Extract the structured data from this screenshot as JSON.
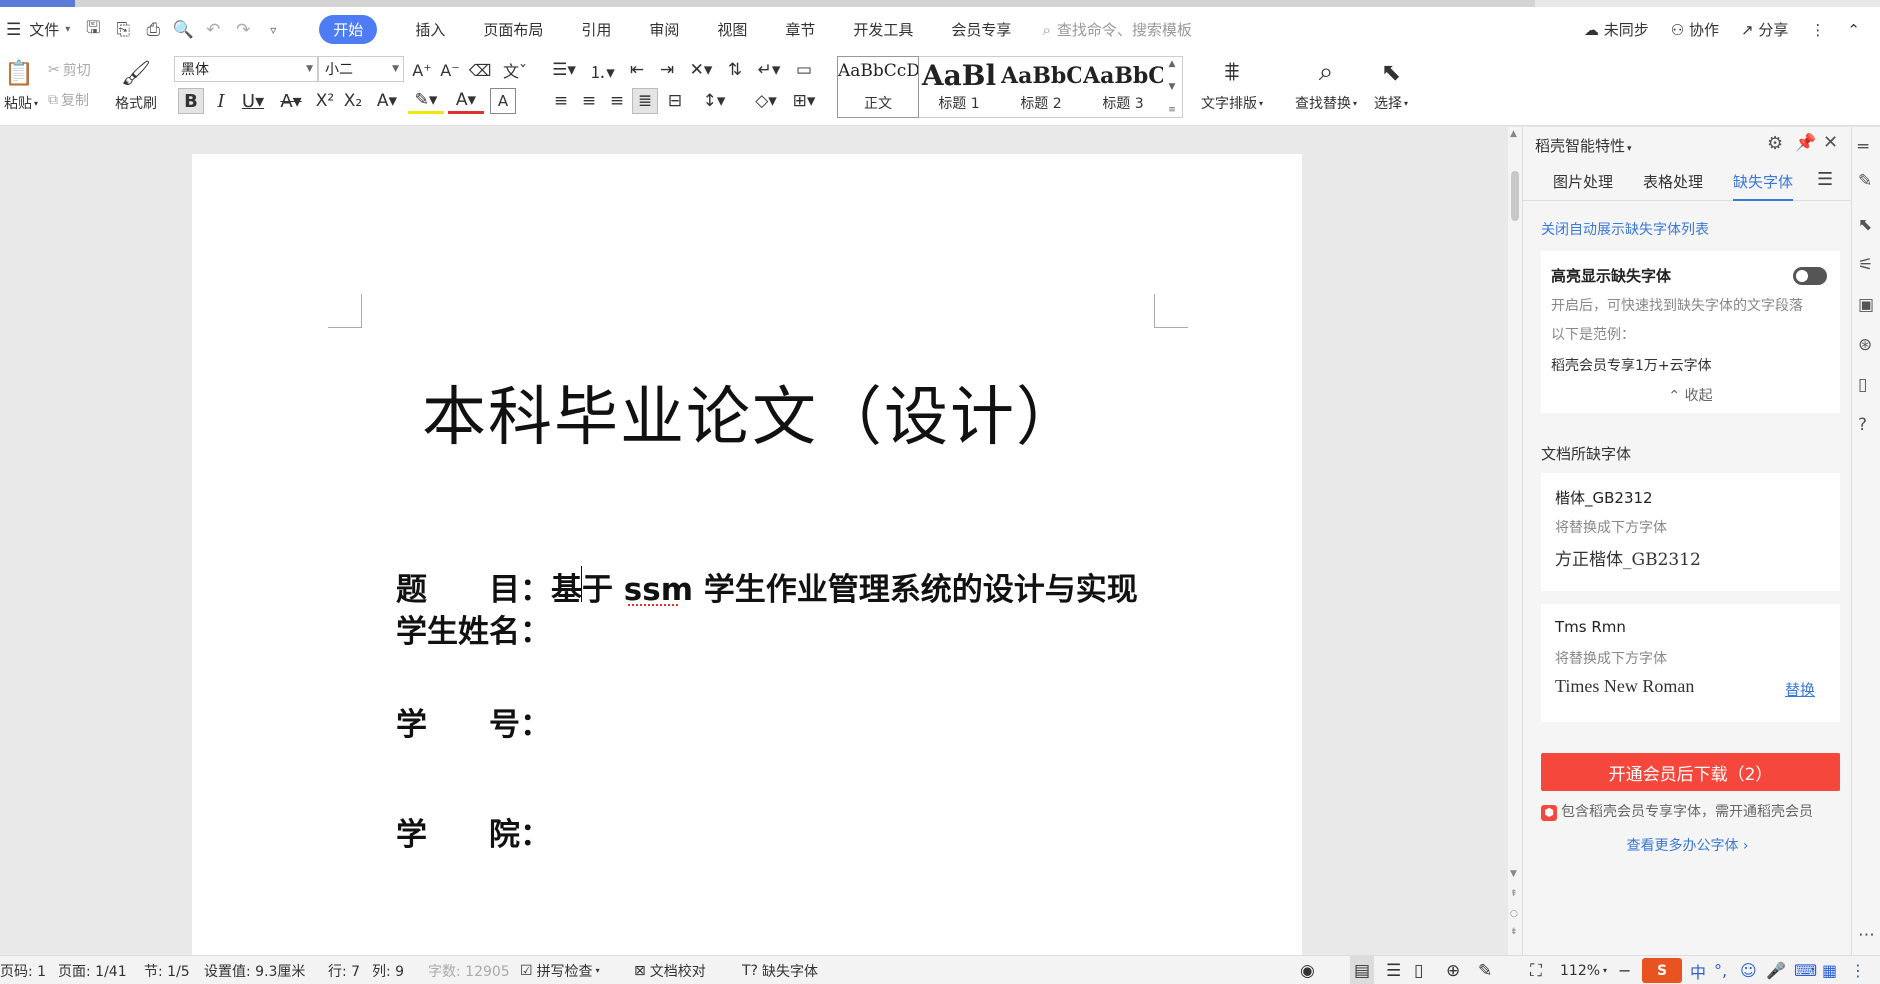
{
  "menubar": {
    "file_label": "文件",
    "tabs": [
      "开始",
      "插入",
      "页面布局",
      "引用",
      "审阅",
      "视图",
      "章节",
      "开发工具",
      "会员专享"
    ],
    "search_placeholder": "查找命令、搜索模板",
    "unsync_label": "未同步",
    "collab_label": "协作",
    "share_label": "分享"
  },
  "ribbon": {
    "paste_label": "粘贴",
    "cut_label": "剪切",
    "copy_label": "复制",
    "format_painter_label": "格式刷",
    "font_name": "黑体",
    "font_size": "小二",
    "styles": [
      {
        "preview": "AaBbCcDd",
        "label": "正文"
      },
      {
        "preview": "AaBl",
        "label": "标题 1"
      },
      {
        "preview": "AaBbC",
        "label": "标题 2"
      },
      {
        "preview": "AaBbC",
        "label": "标题 3"
      }
    ],
    "text_layout_label": "文字排版",
    "find_replace_label": "查找替换",
    "select_label": "选择"
  },
  "document": {
    "title": "本科毕业论文（设计）",
    "lines": [
      {
        "label": "题　　目：",
        "value": "基于 ssm 学生作业管理系统的设计与实现"
      },
      {
        "label": "学生姓名：",
        "value": ""
      },
      {
        "label": "学　　号：",
        "value": ""
      },
      {
        "label": "学　　院：",
        "value": ""
      }
    ]
  },
  "panel": {
    "title": "稻壳智能特性",
    "tabs": [
      "图片处理",
      "表格处理",
      "缺失字体"
    ],
    "close_auto_link": "关闭自动展示缺失字体列表",
    "highlight_title": "高亮显示缺失字体",
    "highlight_desc": "开启后，可快速找到缺失字体的文字段落",
    "example_label": "以下是范例：",
    "example_text": "稻壳会员专享1万+云字体",
    "collapse_label": "收起",
    "missing_section_title": "文档所缺字体",
    "missing_fonts": [
      {
        "name": "楷体_GB2312",
        "hint": "将替换成下方字体",
        "replacement": "方正楷体_GB2312",
        "action": ""
      },
      {
        "name": "Tms Rmn",
        "hint": "将替换成下方字体",
        "replacement": "Times New Roman",
        "action": "替换"
      }
    ],
    "download_button": "开通会员后下载（2）",
    "member_notice": "包含稻壳会员专享字体，需开通稻壳会员",
    "more_link": "查看更多办公字体"
  },
  "statusbar": {
    "page_code": "页码: 1",
    "page": "页面: 1/41",
    "section": "节: 1/5",
    "setting": "设置值: 9.3厘米",
    "row": "行: 7",
    "col": "列: 9",
    "word_count": "字数: 12905",
    "spell_check": "拼写检查",
    "doc_proof": "文档校对",
    "missing_font": "缺失字体",
    "zoom": "112%"
  },
  "colors": {
    "accent": "#4d7cf5",
    "download_button": "#f5473b",
    "link": "#3a78d8"
  }
}
